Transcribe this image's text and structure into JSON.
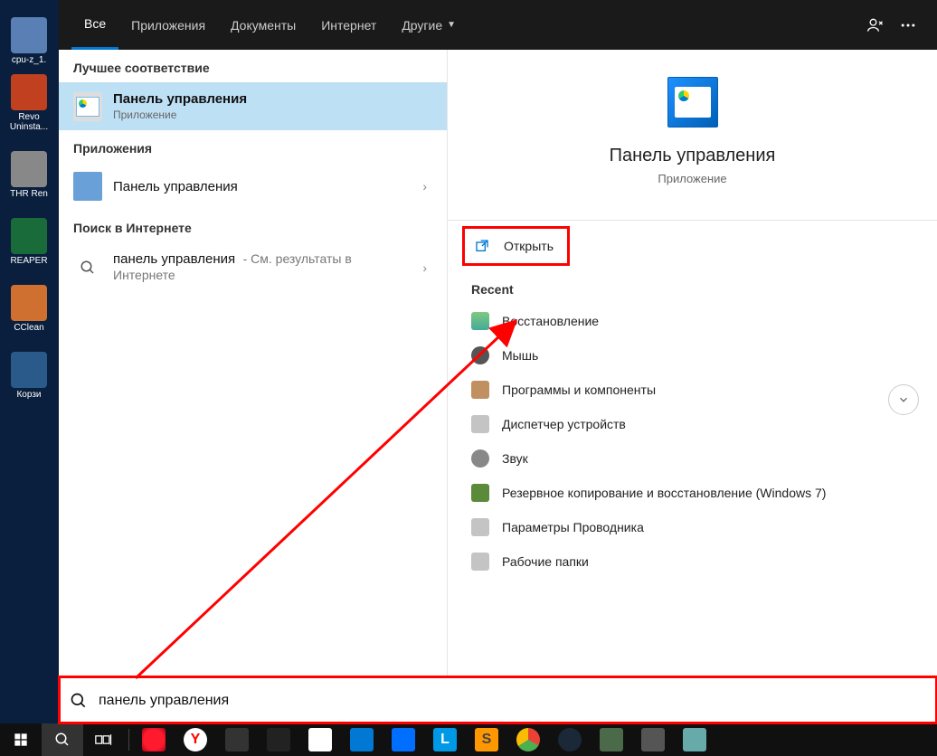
{
  "desktop_icons": [
    {
      "label": "cpu-z_1."
    },
    {
      "label": "Revo Uninsta..."
    },
    {
      "label": "THR Ren"
    },
    {
      "label": "REAPER"
    },
    {
      "label": "CClean"
    },
    {
      "label": "Корзи"
    }
  ],
  "tabs": {
    "all": "Все",
    "apps": "Приложения",
    "docs": "Документы",
    "internet": "Интернет",
    "other": "Другие"
  },
  "left": {
    "best_match_header": "Лучшее соответствие",
    "best_match": {
      "title": "Панель управления",
      "subtitle": "Приложение"
    },
    "apps_header": "Приложения",
    "app_result": {
      "title": "Панель управления"
    },
    "web_header": "Поиск в Интернете",
    "web_result": {
      "prefix": "панель управления",
      "suffix": "- См. результаты в Интернете"
    }
  },
  "right": {
    "title": "Панель управления",
    "subtitle": "Приложение",
    "open_action": "Открыть",
    "recent_header": "Recent",
    "recent": [
      "Восстановление",
      "Мышь",
      "Программы и компоненты",
      "Диспетчер устройств",
      "Звук",
      "Резервное копирование и восстановление (Windows 7)",
      "Параметры Проводника",
      "Рабочие папки"
    ]
  },
  "search_value": "панель управления",
  "taskbar_apps": [
    "start",
    "search",
    "taskview",
    "opera",
    "yandex",
    "app1",
    "app2",
    "app3",
    "mail",
    "blue",
    "L",
    "S",
    "chrome",
    "steam",
    "app4",
    "app5"
  ]
}
